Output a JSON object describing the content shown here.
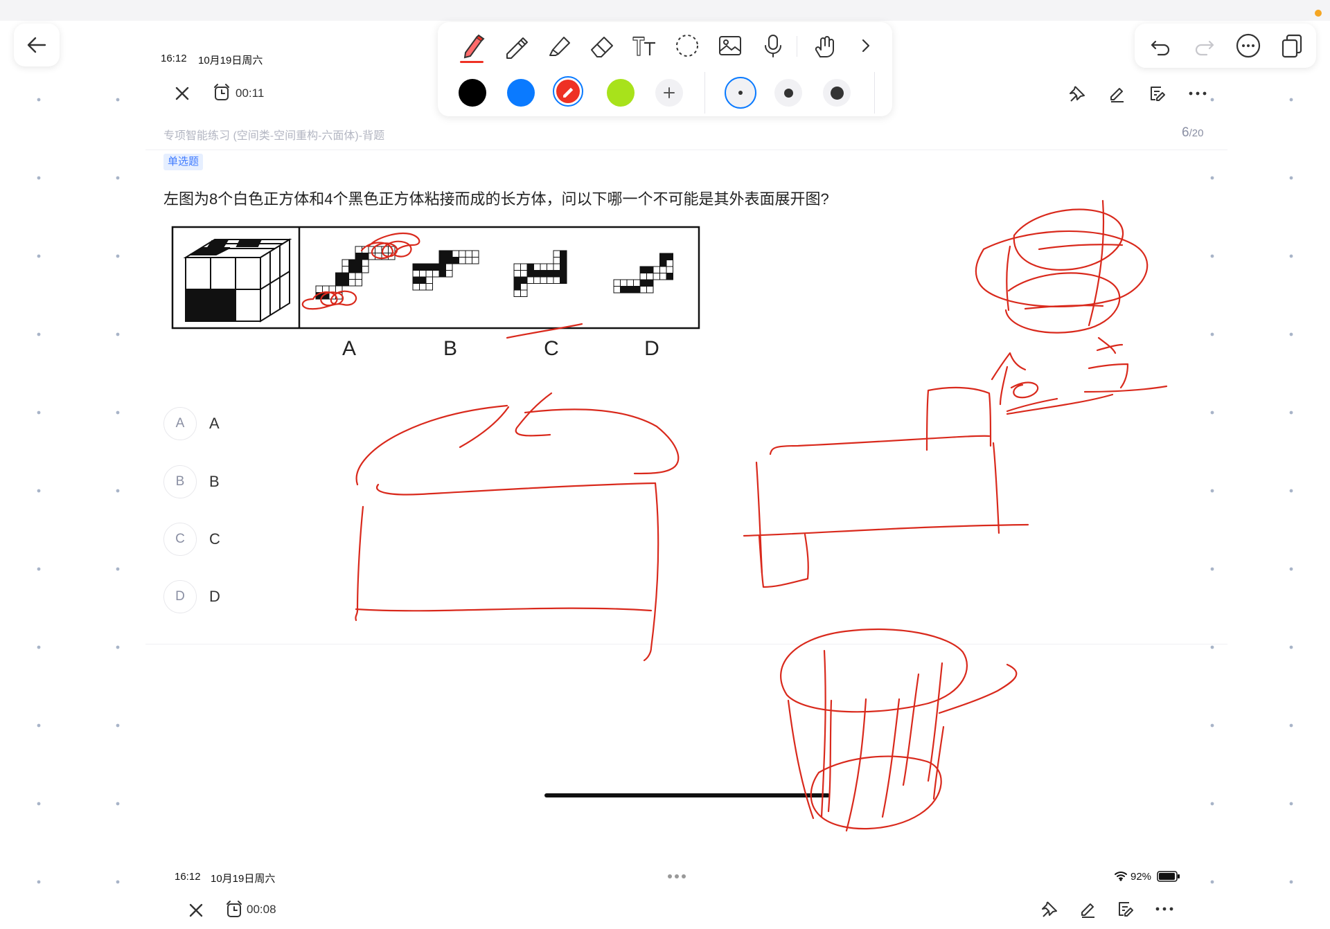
{
  "top_bar": {
    "time": "16:12",
    "date": "10月19日周六",
    "timer": "00:11"
  },
  "header": {
    "breadcrumb": "专项智能练习 (空间类-空间重构-六面体)-背题",
    "progress_current": "6",
    "progress_total": "/20"
  },
  "question": {
    "type_badge": "单选题",
    "text": "左图为8个白色正方体和4个黑色正方体粘接而成的长方体，问以下哪一个不可能是其外表面展开图?",
    "figure_labels": [
      "A",
      "B",
      "C",
      "D"
    ],
    "options": [
      {
        "key": "A",
        "text": "A"
      },
      {
        "key": "B",
        "text": "B"
      },
      {
        "key": "C",
        "text": "C"
      },
      {
        "key": "D",
        "text": "D"
      }
    ]
  },
  "toolbar": {
    "tools": [
      "pen-icon",
      "pencil-icon",
      "highlighter-icon",
      "eraser-icon",
      "text-icon",
      "lasso-icon",
      "image-icon",
      "microphone-icon",
      "hand-gesture-icon",
      "chevron-right-icon"
    ],
    "colors": [
      "#000000",
      "#0a7aff",
      "#ee3124",
      "#a8e21b"
    ],
    "selected_color": "#ee3124",
    "sizes": [
      "small",
      "medium",
      "large"
    ],
    "selected_size": "small"
  },
  "bottom_bar": {
    "time": "16:12",
    "date": "10月19日周六",
    "timer": "00:08",
    "wifi_icon": "wifi-icon",
    "battery": "92%"
  },
  "ink_color": "#d9291c"
}
